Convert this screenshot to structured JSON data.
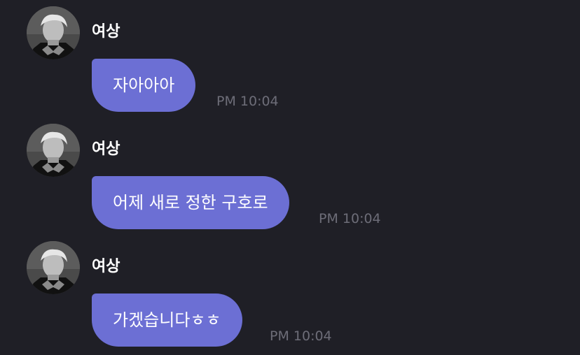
{
  "messages": [
    {
      "sender": "여상",
      "text": "자아아아",
      "time": "PM 10:04"
    },
    {
      "sender": "여상",
      "text": "어제 새로 정한 구호로",
      "time": "PM 10:04"
    },
    {
      "sender": "여상",
      "text": "가겠습니다ㅎㅎ",
      "time": "PM 10:04"
    }
  ],
  "colors": {
    "background": "#1f1f26",
    "bubble": "#6c6fd4",
    "sender_text": "#ffffff",
    "time_text": "#6d6d78"
  },
  "icons": {
    "avatar": "profile-avatar-photo"
  }
}
